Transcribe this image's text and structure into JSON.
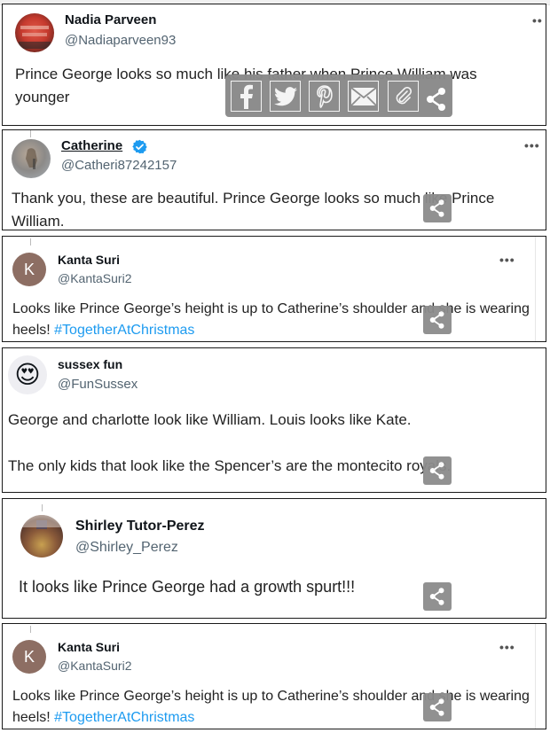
{
  "share_bar": {
    "buttons": [
      {
        "name": "facebook",
        "icon": "facebook-icon"
      },
      {
        "name": "twitter",
        "icon": "twitter-bird-icon"
      },
      {
        "name": "pinterest",
        "icon": "pinterest-icon"
      },
      {
        "name": "email",
        "icon": "envelope-icon"
      },
      {
        "name": "copy-link",
        "icon": "paperclip-icon"
      },
      {
        "name": "share",
        "icon": "share-icon"
      }
    ]
  },
  "tweets": [
    {
      "name": "Nadia Parveen",
      "handle": "@Nadiaparveen93",
      "text": "Prince George looks so much like his father when Prince William was younger",
      "more": "••",
      "avatar": "group-photo-red"
    },
    {
      "name": "Catherine",
      "verified": true,
      "handle": "@Catheri87242157",
      "text": "Thank you, these are beautiful. Prince George looks so much like Prince William.",
      "more": "•••",
      "avatar": "photo-grey"
    },
    {
      "name": "Kanta Suri",
      "handle": "@KantaSuri2",
      "text": "Looks like Prince George’s height is up to Catherine’s shoulder and she is wearing heels! ",
      "hashtag": "#TogetherAtChristmas",
      "more": "•••",
      "avatar_letter": "K"
    },
    {
      "name": "sussex fun",
      "handle": "@FunSussex",
      "text_line1": "George and charlotte look like William. Louis looks like Kate.",
      "text_line2": "The only kids that look like the Spencer’s are the montecito royals.",
      "avatar_emoji": "😍"
    },
    {
      "name": "Shirley Tutor-Perez",
      "handle": "@Shirley_Perez",
      "text": "It looks like Prince George had a growth spurt!!!",
      "avatar": "photo-room"
    },
    {
      "name": "Kanta Suri",
      "handle": "@KantaSuri2",
      "text": "Looks like Prince George’s height is up to Catherine’s shoulder and she is wearing heels! ",
      "hashtag": "#TogetherAtChristmas",
      "more": "•••",
      "avatar_letter": "K"
    }
  ],
  "colors": {
    "hashtag": "#1d9bf0",
    "verified": "#1d9bf0",
    "avatar_k": "#8d6e63",
    "share_gray": "#8c8c8c"
  }
}
